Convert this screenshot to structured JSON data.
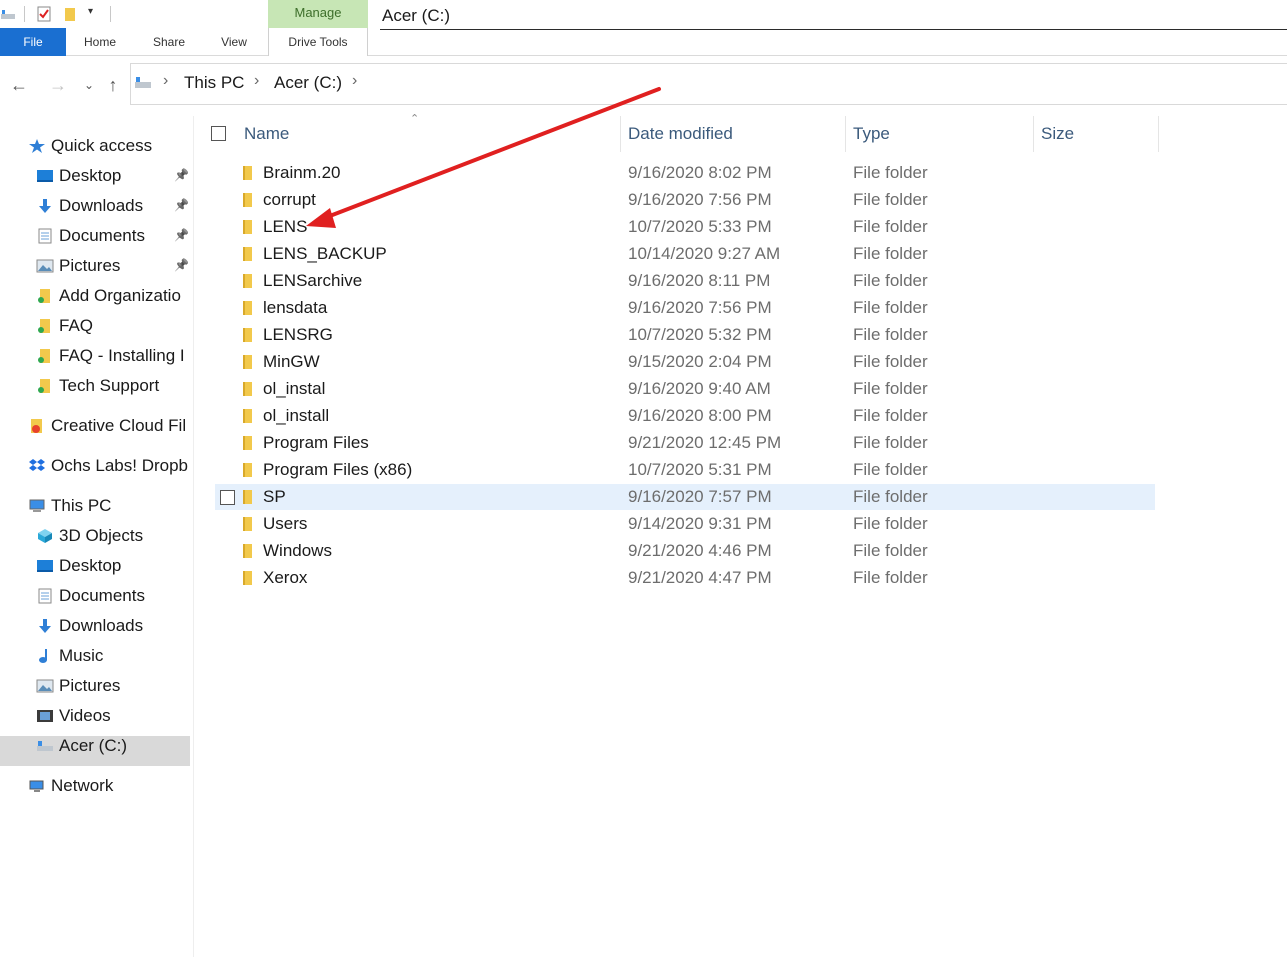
{
  "window": {
    "title": "Acer (C:)",
    "ribbon_context_group": "Manage"
  },
  "ribbon": {
    "tabs": [
      {
        "label": "File"
      },
      {
        "label": "Home"
      },
      {
        "label": "Share"
      },
      {
        "label": "View"
      },
      {
        "label": "Drive Tools"
      }
    ]
  },
  "address": {
    "breadcrumbs": [
      "This PC",
      "Acer (C:)"
    ]
  },
  "sidebar": {
    "items": [
      {
        "label": "Quick access",
        "icon": "star-icon"
      },
      {
        "label": "Desktop",
        "icon": "desktop-icon",
        "pinned": true
      },
      {
        "label": "Downloads",
        "icon": "download-icon",
        "pinned": true
      },
      {
        "label": "Documents",
        "icon": "documents-icon",
        "pinned": true
      },
      {
        "label": "Pictures",
        "icon": "pictures-icon",
        "pinned": true
      },
      {
        "label": "Add Organizatio",
        "icon": "folder-icon"
      },
      {
        "label": "FAQ",
        "icon": "folder-icon"
      },
      {
        "label": "FAQ - Installing I",
        "icon": "folder-icon"
      },
      {
        "label": "Tech Support",
        "icon": "folder-icon"
      },
      {
        "label": "Creative Cloud Fil",
        "icon": "creative-cloud-icon"
      },
      {
        "label": "Ochs Labs! Dropb",
        "icon": "dropbox-icon"
      },
      {
        "label": "This PC",
        "icon": "computer-icon"
      },
      {
        "label": "3D Objects",
        "icon": "3d-objects-icon"
      },
      {
        "label": "Desktop",
        "icon": "desktop-icon"
      },
      {
        "label": "Documents",
        "icon": "documents-icon"
      },
      {
        "label": "Downloads",
        "icon": "download-icon"
      },
      {
        "label": "Music",
        "icon": "music-icon"
      },
      {
        "label": "Pictures",
        "icon": "pictures-icon"
      },
      {
        "label": "Videos",
        "icon": "videos-icon"
      },
      {
        "label": "Acer (C:)",
        "icon": "drive-icon",
        "selected": true
      },
      {
        "label": "Network",
        "icon": "network-icon"
      }
    ]
  },
  "columns": {
    "name": "Name",
    "date": "Date modified",
    "type": "Type",
    "size": "Size"
  },
  "files": [
    {
      "name": "Brainm.20",
      "date": "9/16/2020 8:02 PM",
      "type": "File folder"
    },
    {
      "name": "corrupt",
      "date": "9/16/2020 7:56 PM",
      "type": "File folder"
    },
    {
      "name": "LENS",
      "date": "10/7/2020 5:33 PM",
      "type": "File folder"
    },
    {
      "name": "LENS_BACKUP",
      "date": "10/14/2020 9:27 AM",
      "type": "File folder"
    },
    {
      "name": "LENSarchive",
      "date": "9/16/2020 8:11 PM",
      "type": "File folder"
    },
    {
      "name": "lensdata",
      "date": "9/16/2020 7:56 PM",
      "type": "File folder"
    },
    {
      "name": "LENSRG",
      "date": "10/7/2020 5:32 PM",
      "type": "File folder"
    },
    {
      "name": "MinGW",
      "date": "9/15/2020 2:04 PM",
      "type": "File folder"
    },
    {
      "name": "ol_instal",
      "date": "9/16/2020 9:40 AM",
      "type": "File folder"
    },
    {
      "name": "ol_install",
      "date": "9/16/2020 8:00 PM",
      "type": "File folder"
    },
    {
      "name": "Program Files",
      "date": "9/21/2020 12:45 PM",
      "type": "File folder"
    },
    {
      "name": "Program Files (x86)",
      "date": "10/7/2020 5:31 PM",
      "type": "File folder"
    },
    {
      "name": "SP",
      "date": "9/16/2020 7:57 PM",
      "type": "File folder",
      "hovered": true
    },
    {
      "name": "Users",
      "date": "9/14/2020 9:31 PM",
      "type": "File folder"
    },
    {
      "name": "Windows",
      "date": "9/21/2020 4:46 PM",
      "type": "File folder"
    },
    {
      "name": "Xerox",
      "date": "9/21/2020 4:47 PM",
      "type": "File folder"
    }
  ],
  "colors": {
    "file_tab": "#1a6fd1",
    "context_group": "#c7e6b5",
    "row_hover": "#e5f0fc",
    "folder": "#f2c94c",
    "annotation_arrow": "#e02020"
  }
}
